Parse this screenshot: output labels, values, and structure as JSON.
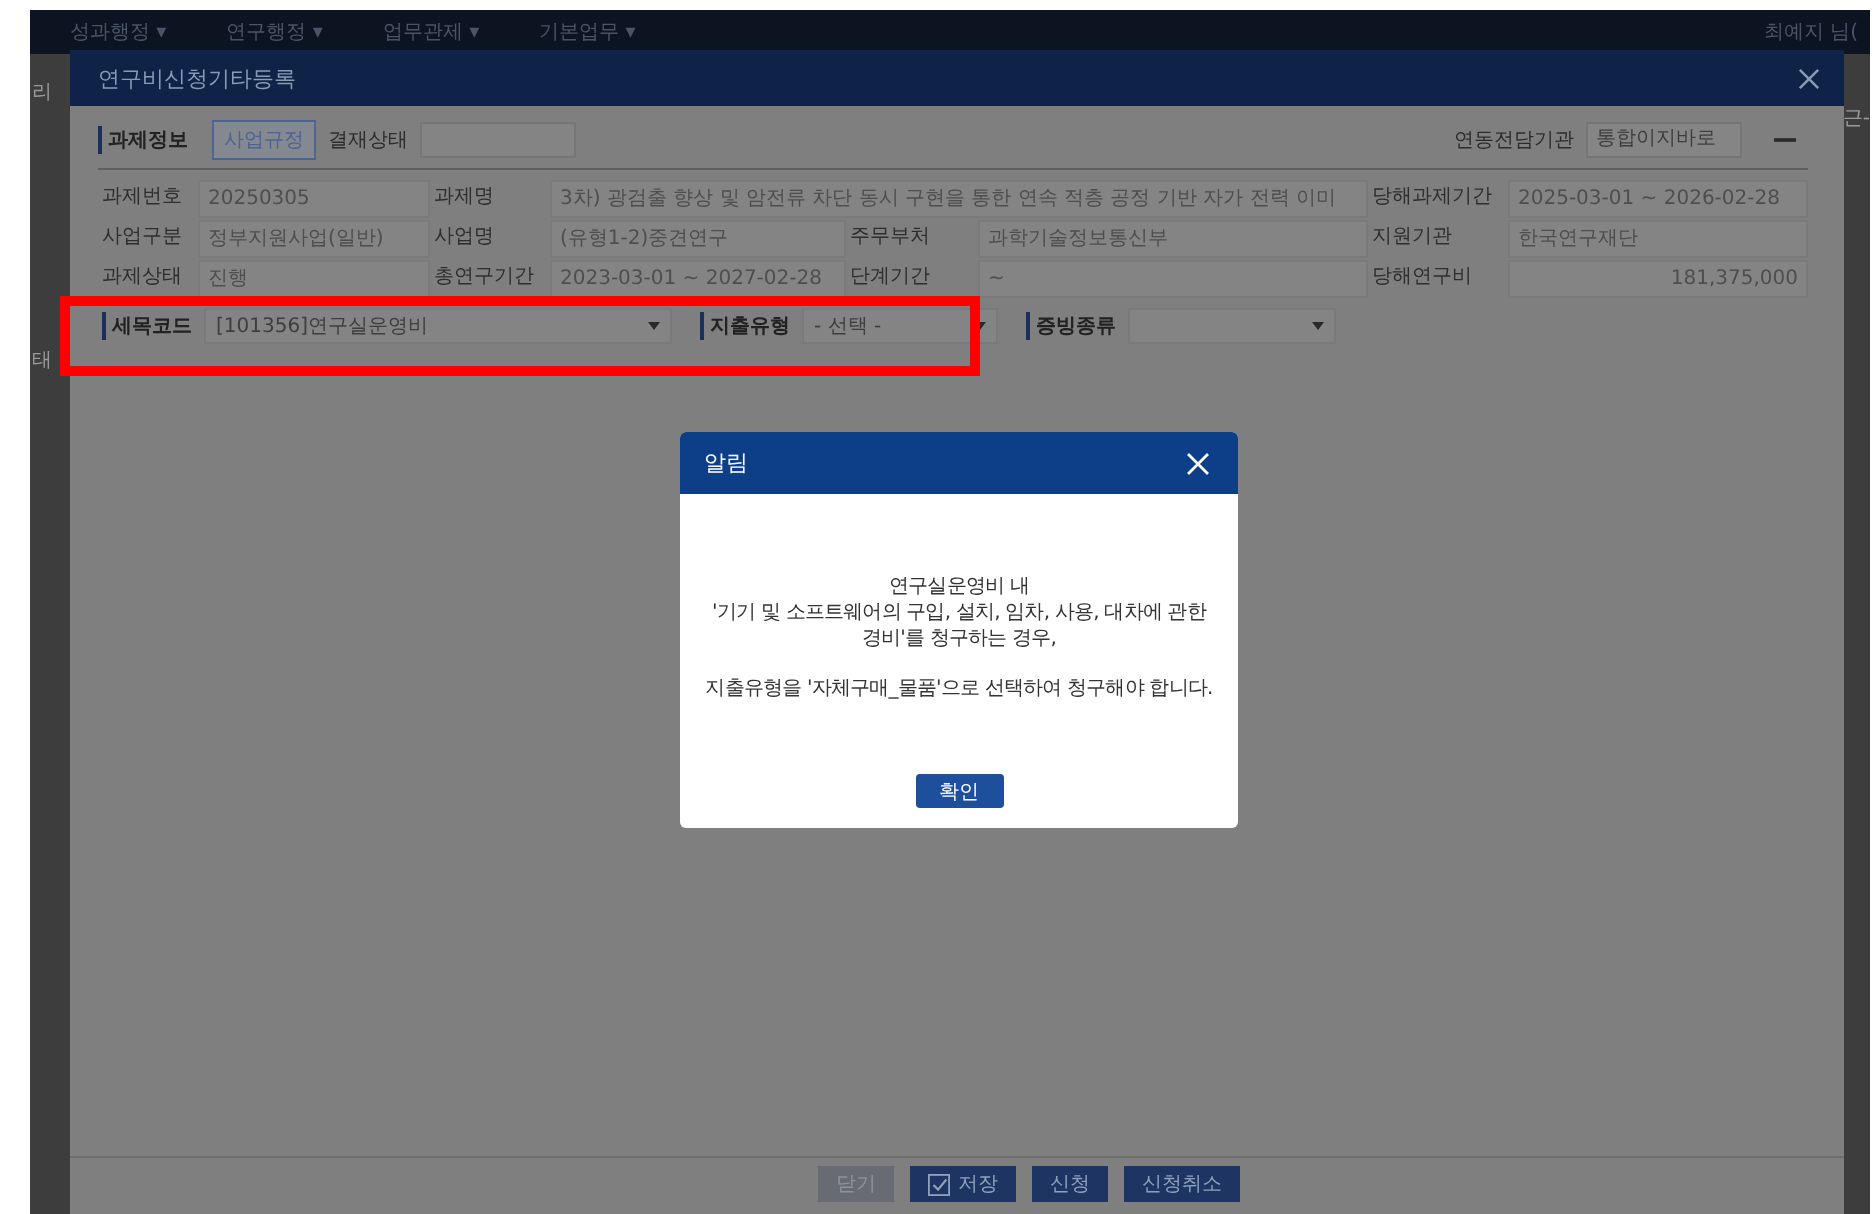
{
  "nav": {
    "menus": [
      {
        "label": "성과행정 ▾"
      },
      {
        "label": "연구행정 ▾"
      },
      {
        "label": "업무관제 ▾"
      },
      {
        "label": "기본업무 ▾"
      }
    ],
    "user": "최예지 님("
  },
  "background_fragments": {
    "left": [
      "리",
      "태"
    ],
    "right": [
      "근-"
    ]
  },
  "dialog": {
    "title": "연구비신청기타등록",
    "section": "과제정보",
    "rules_button": "사업규정",
    "approval_label": "결재상태",
    "agency_label": "연동전담기관",
    "agency_value": "통합이지바로",
    "info_rows": [
      [
        {
          "label": "과제번호",
          "value": "20250305"
        },
        {
          "label": "과제명",
          "value": "3차) 광검출 향상 및 암전류 차단 동시 구현을 통한 연속 적층 공정 기반 자가 전력 이미",
          "wide": true
        },
        {
          "label": "당해과제기간",
          "value": "2025-03-01 ~ 2026-02-28"
        }
      ],
      [
        {
          "label": "사업구분",
          "value": "정부지원사업(일반)"
        },
        {
          "label": "사업명",
          "value": "(유형1-2)중견연구"
        },
        {
          "label": "주무부처",
          "value": "과학기술정보통신부"
        },
        {
          "label": "지원기관",
          "value": "한국연구재단"
        }
      ],
      [
        {
          "label": "과제상태",
          "value": "진행"
        },
        {
          "label": "총연구기간",
          "value": "2023-03-01 ~ 2027-02-28"
        },
        {
          "label": "단계기간",
          "value": "~"
        },
        {
          "label": "당해연구비",
          "value": "181,375,000",
          "numeric": true
        }
      ]
    ],
    "filters": [
      {
        "label": "세목코드",
        "value": "[101356]연구실운영비"
      },
      {
        "label": "지출유형",
        "value": "- 선택 -"
      },
      {
        "label": "증빙종류"
      }
    ],
    "filter_highlight": true,
    "buttons": [
      {
        "label": "닫기",
        "kind": "secondary"
      },
      {
        "label": "저장",
        "kind": "save"
      },
      {
        "label": "신청",
        "kind": "primary"
      },
      {
        "label": "신청취소",
        "kind": "primary"
      }
    ]
  },
  "alert": {
    "title": "알림",
    "paragraphs": [
      "연구실운영비 내\n'기기 및 소프트웨어의 구입, 설치, 임차, 사용, 대차에 관한\n경비'를 청구하는 경우,",
      "지출유형을 '자체구매_물품'으로 선택하여 청구해야 합니다."
    ],
    "confirm": "확인"
  }
}
